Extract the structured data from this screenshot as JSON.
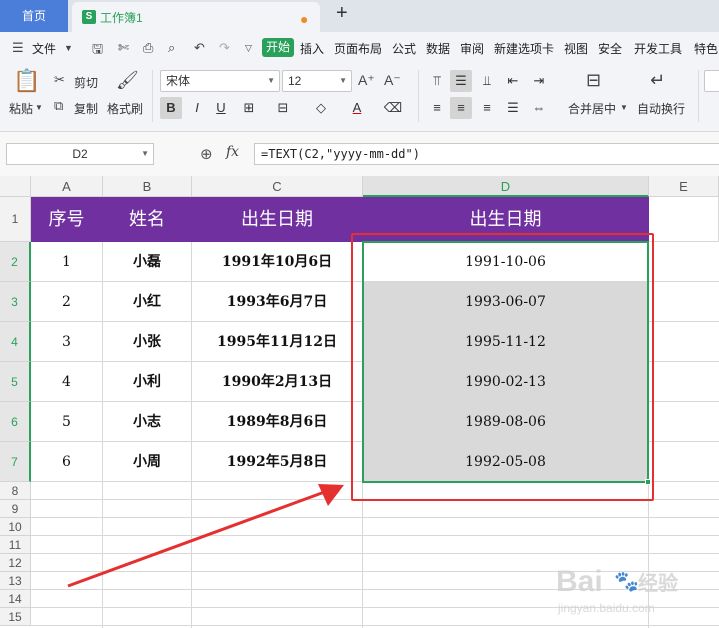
{
  "titlebar": {
    "home_tab": "首页",
    "doc_tab": "工作簿1",
    "doc_icon_letter": "S",
    "new_tab_icon": "plus-icon"
  },
  "menubar": {
    "file": "文件",
    "start": "开始",
    "items": [
      "插入",
      "页面布局",
      "公式",
      "数据",
      "审阅",
      "新建选项卡",
      "视图",
      "安全",
      "开发工具",
      "特色"
    ]
  },
  "ribbon": {
    "paste": "粘贴",
    "cut": "剪切",
    "copy": "复制",
    "format_painter": "格式刷",
    "font_name": "宋体",
    "font_size": "12",
    "merge_center": "合并居中",
    "wrap_text": "自动换行"
  },
  "formulabar": {
    "cell_ref": "D2",
    "fx": "fx",
    "formula": "=TEXT(C2,\"yyyy-mm-dd\")"
  },
  "sheet": {
    "columns": [
      "A",
      "B",
      "C",
      "D",
      "E"
    ],
    "rows": [
      "1",
      "2",
      "3",
      "4",
      "5",
      "6",
      "7",
      "8",
      "9",
      "10",
      "11",
      "12",
      "13",
      "14",
      "15"
    ],
    "header": [
      "序号",
      "姓名",
      "出生日期",
      "出生日期"
    ],
    "data": [
      [
        "1",
        "小磊",
        "1991年10月6日",
        "1991-10-06"
      ],
      [
        "2",
        "小红",
        "1993年6月7日",
        "1993-06-07"
      ],
      [
        "3",
        "小张",
        "1995年11月12日",
        "1995-11-12"
      ],
      [
        "4",
        "小利",
        "1990年2月13日",
        "1990-02-13"
      ],
      [
        "5",
        "小志",
        "1989年8月6日",
        "1989-08-06"
      ],
      [
        "6",
        "小周",
        "1992年5月8日",
        "1992-05-08"
      ]
    ]
  },
  "colors": {
    "accent": "#2aa15a",
    "header_fill": "#7030a0",
    "annotation": "#e53030",
    "home_tab": "#4a7ed9"
  }
}
